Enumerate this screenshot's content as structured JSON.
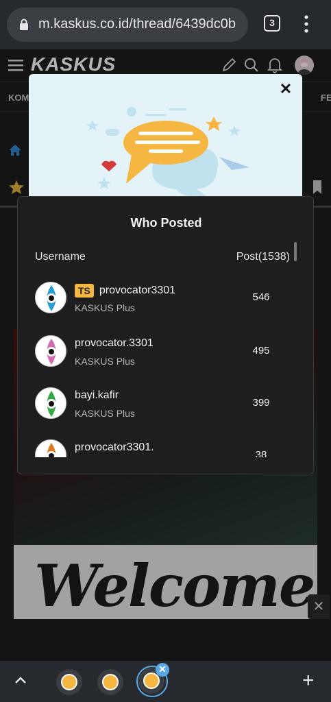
{
  "browser": {
    "url": "m.kaskus.co.id/thread/6439dc0b",
    "tab_count": "3"
  },
  "header": {
    "logo": "KASKUS",
    "nav_left": "KOM",
    "nav_right": "FE"
  },
  "background": {
    "welcome_text": "Welcome"
  },
  "modal": {
    "title": "Who Posted",
    "col_username": "Username",
    "col_posts": "Post(1538)",
    "rows": [
      {
        "badge": "TS",
        "username": "provocator3301",
        "role": "KASKUS Plus",
        "posts": "546",
        "eye_color": "#2a9bd6"
      },
      {
        "badge": "",
        "username": "provocator.3301",
        "role": "KASKUS Plus",
        "posts": "495",
        "eye_color": "#d46ab2"
      },
      {
        "badge": "",
        "username": "bayi.kafir",
        "role": "KASKUS Plus",
        "posts": "399",
        "eye_color": "#33a845"
      },
      {
        "badge": "",
        "username": "provocator3301.",
        "role": "",
        "posts": "38",
        "eye_color": "#e07a22"
      }
    ]
  },
  "colors": {
    "accent_blue": "#5aa9e6",
    "badge_yellow": "#f5b642",
    "modal_bg": "#1e1e1e",
    "illustration_bg": "#e3f3f8"
  }
}
